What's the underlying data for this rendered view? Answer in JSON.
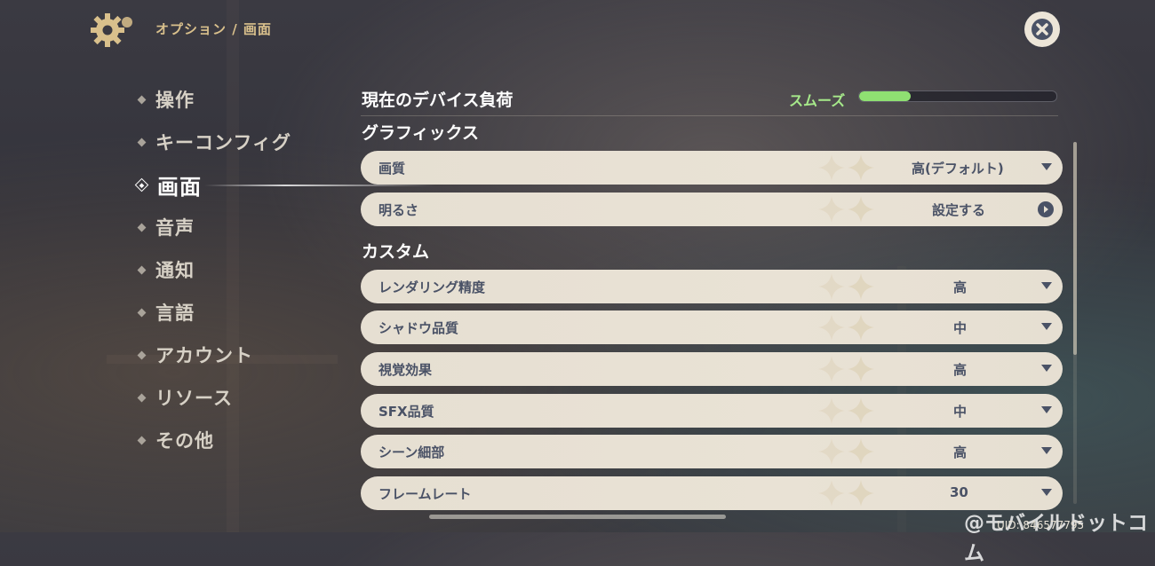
{
  "header": {
    "breadcrumb": "オプション / 画面",
    "settings_icon": "gear-icon",
    "close_icon": "close-icon"
  },
  "sidebar": {
    "items": [
      {
        "label": "操作",
        "active": false
      },
      {
        "label": "キーコンフィグ",
        "active": false
      },
      {
        "label": "画面",
        "active": true
      },
      {
        "label": "音声",
        "active": false
      },
      {
        "label": "通知",
        "active": false
      },
      {
        "label": "言語",
        "active": false
      },
      {
        "label": "アカウント",
        "active": false
      },
      {
        "label": "リソース",
        "active": false
      },
      {
        "label": "その他",
        "active": false
      }
    ]
  },
  "device_load": {
    "title": "現在のデバイス負荷",
    "status": "スムーズ",
    "level_fraction": 0.26,
    "color": "#8fe072"
  },
  "graphics": {
    "title": "グラフィックス",
    "options": [
      {
        "name": "画質",
        "value": "高(デフォルト)",
        "control": "dropdown"
      },
      {
        "name": "明るさ",
        "value": "設定する",
        "control": "arrow"
      }
    ]
  },
  "custom": {
    "title": "カスタム",
    "options": [
      {
        "name": "レンダリング精度",
        "value": "高"
      },
      {
        "name": "シャドウ品質",
        "value": "中"
      },
      {
        "name": "視覚効果",
        "value": "高"
      },
      {
        "name": "SFX品質",
        "value": "中"
      },
      {
        "name": "シーン細部",
        "value": "高"
      },
      {
        "name": "フレームレート",
        "value": "30"
      }
    ]
  },
  "footer": {
    "uid": "UID: 846577795",
    "watermark": "@モバイルドットコム"
  }
}
